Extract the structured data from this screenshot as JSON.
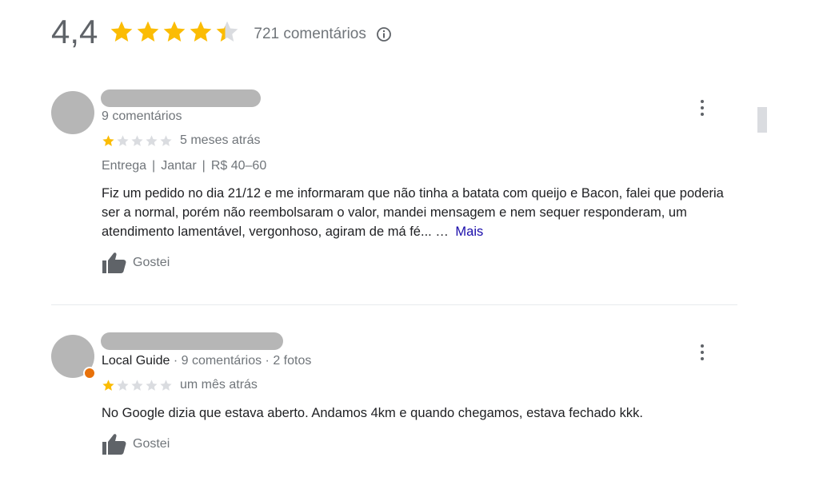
{
  "summary": {
    "rating": "4,4",
    "stars": 4.4,
    "count_label": "721 comentários",
    "info_icon": "info-icon"
  },
  "colors": {
    "star_filled": "#fbbc04",
    "star_empty": "#dadce0",
    "link": "#1a0dab",
    "muted_text": "#70757a",
    "placeholder": "#b6b6b6"
  },
  "reviews": [
    {
      "reviewer_meta": "9 comentários",
      "stars": 1,
      "when": "5 meses atrás",
      "tags": [
        "Entrega",
        "Jantar",
        "R$ 40–60"
      ],
      "text": "Fiz um pedido no dia 21/12 e me informaram que não tinha a batata com queijo e Bacon, falei que poderia ser a normal, porém não reembolsaram o valor, mandei mensagem e nem sequer responderam, um atendimento lamentável, vergonhoso, agiram de má fé...",
      "ellipsis": "…",
      "more_label": "Mais",
      "like_label": "Gostei"
    },
    {
      "reviewer_badge": "Local Guide",
      "reviewer_meta": " · 9 comentários · 2 fotos",
      "stars": 1,
      "when": "um mês atrás",
      "text": "No Google dizia que estava aberto. Andamos 4km e quando chegamos, estava fechado kkk.",
      "like_label": "Gostei"
    }
  ]
}
